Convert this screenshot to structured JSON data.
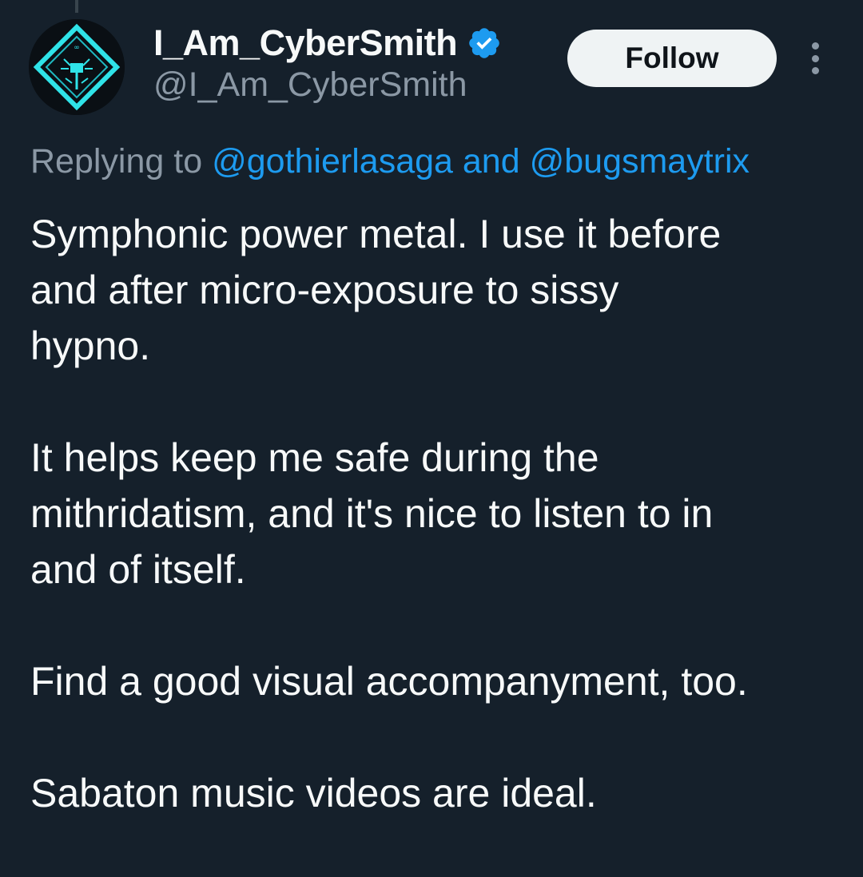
{
  "author": {
    "display_name": "I_Am_CyberSmith",
    "handle": "@I_Am_CyberSmith",
    "verified": true
  },
  "follow_label": "Follow",
  "reply_context": {
    "prefix": "Replying to",
    "mention_1": "@gothierlasaga",
    "conjunction": "and",
    "mention_2": "@bugsmaytrix"
  },
  "tweet": {
    "paragraphs": [
      [
        "Symphonic power metal. I use it before",
        "and after micro-exposure to sissy",
        "hypno."
      ],
      [
        "It helps keep me safe during the",
        "mithridatism, and it's nice to listen to in",
        "and of itself."
      ],
      [
        "Find a good visual accompanyment, too."
      ],
      [
        "Sabaton music videos are ideal."
      ]
    ]
  },
  "icons": {
    "verified": "verified-badge-icon",
    "more": "more-options-icon"
  },
  "colors": {
    "background": "#15202b",
    "text_primary": "#f7f9f9",
    "text_secondary": "#8b98a5",
    "accent": "#1d9bf0",
    "follow_bg": "#eff3f4"
  }
}
